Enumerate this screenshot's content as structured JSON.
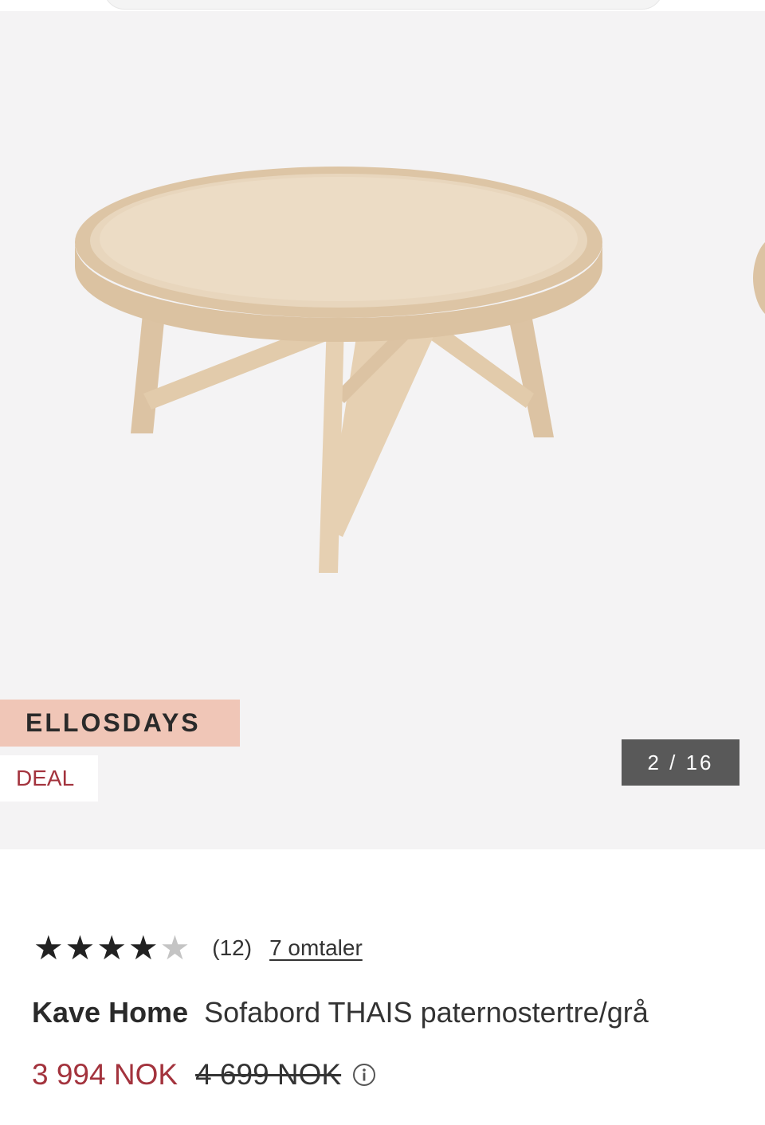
{
  "gallery": {
    "campaign_badge": "ELLOSDAYS",
    "deal_badge": "DEAL",
    "counter": "2 / 16"
  },
  "rating": {
    "stars": 4,
    "max_stars": 5,
    "count": "(12)",
    "reviews_link": "7 omtaler"
  },
  "product": {
    "brand": "Kave Home",
    "name": "Sofabord THAIS paternostertre/grå",
    "price_current": "3 994 NOK",
    "price_original": "4 699 NOK"
  },
  "colors": {
    "accent_red": "#a3333d",
    "campaign_bg": "#f0c6b7",
    "gallery_bg": "#f4f3f4",
    "wood": "#e3cdb0"
  }
}
